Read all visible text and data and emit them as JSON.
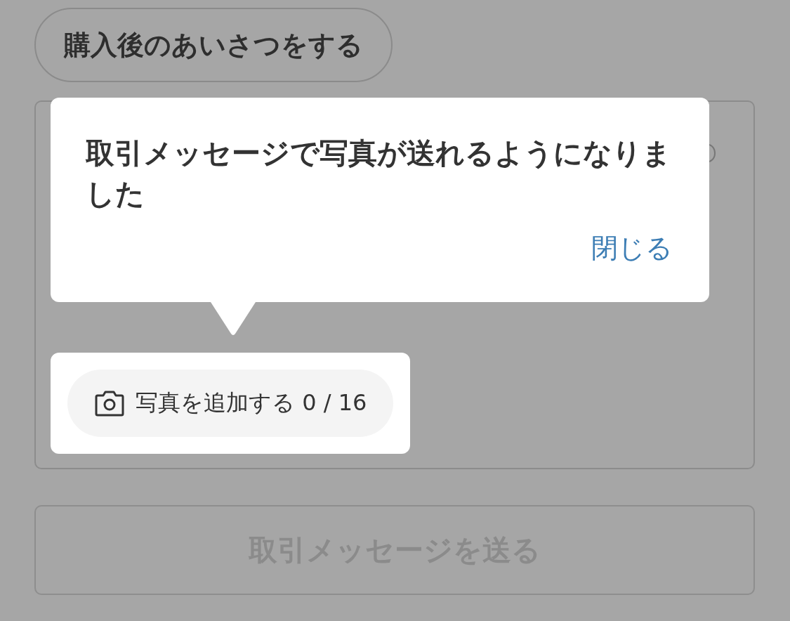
{
  "greeting_button": {
    "label": "購入後のあいさつをする"
  },
  "message_box": {
    "tooltip": {
      "message": "取引メッセージで写真が送れるようになりました",
      "close_link": "閉じる"
    },
    "photo_button": {
      "label": "写真を追加する 0 / 16"
    }
  },
  "send_button": {
    "label": "取引メッセージを送る",
    "disabled": true
  }
}
